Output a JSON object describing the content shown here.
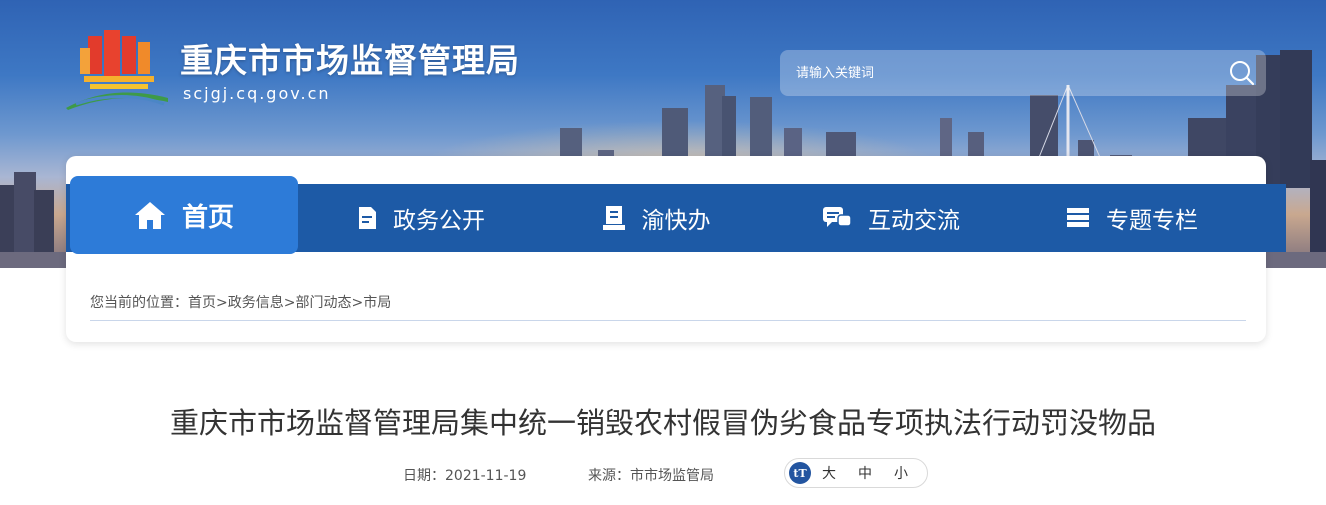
{
  "header": {
    "site_title": "重庆市市场监督管理局",
    "site_domain": "scjgj.cq.gov.cn",
    "logo": "government-building-logo"
  },
  "search": {
    "placeholder": "请输入关键词",
    "icon": "search-icon"
  },
  "nav": {
    "items": [
      {
        "label": "首页",
        "icon": "home-icon",
        "active": true
      },
      {
        "label": "政务公开",
        "icon": "document-icon"
      },
      {
        "label": "渝快办",
        "icon": "book-icon"
      },
      {
        "label": "互动交流",
        "icon": "chat-icon"
      },
      {
        "label": "专题专栏",
        "icon": "stack-icon"
      }
    ]
  },
  "breadcrumb": {
    "prefix": "您当前的位置：",
    "items": [
      "首页",
      "政务信息",
      "部门动态",
      "市局"
    ],
    "separator": ">"
  },
  "article": {
    "title": "重庆市市场监督管理局集中统一销毁农村假冒伪劣食品专项执法行动罚没物品",
    "date_label": "日期：2021-11-19",
    "source_label": "来源：市市场监管局",
    "font_size_icon": "tT",
    "font_sizes": [
      "大",
      "中",
      "小"
    ]
  },
  "colors": {
    "nav_bg": "#1d5aa6",
    "nav_active": "#2d7bd8",
    "brand_blue": "#2355a0"
  }
}
